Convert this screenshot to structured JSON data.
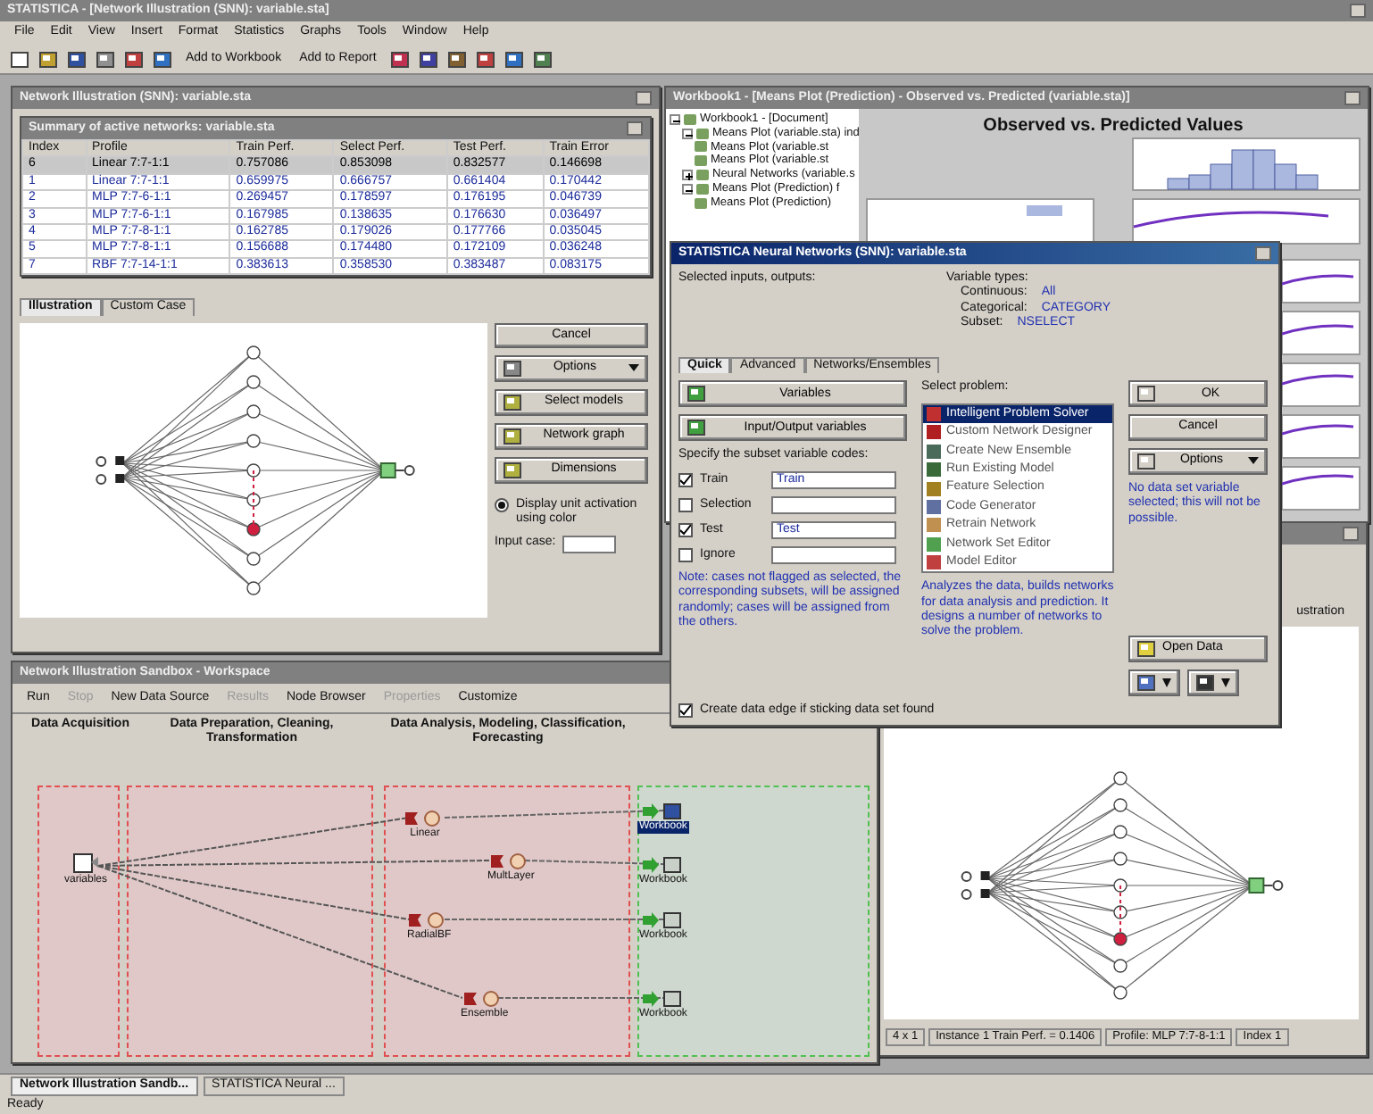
{
  "app": {
    "title": "STATISTICA - [Network Illustration (SNN): variable.sta]",
    "menu": [
      "File",
      "Edit",
      "View",
      "Insert",
      "Format",
      "Statistics",
      "Graphs",
      "Tools",
      "Window",
      "Help"
    ],
    "toolbar": [
      "Add to Workbook",
      "Add to Report"
    ]
  },
  "illustration_window": {
    "title": "Network Illustration (SNN): variable.sta",
    "results": {
      "title": "Summary of active networks: variable.sta",
      "columns": [
        "Index",
        "Profile",
        "Train Perf.",
        "Select Perf.",
        "Test Perf.",
        "Train Error"
      ],
      "rows": [
        {
          "cells": [
            "6",
            "Linear 7:7-1:1",
            "0.757086",
            "0.853098",
            "0.832577",
            "0.146698"
          ],
          "selected": true
        },
        {
          "cells": [
            "1",
            "Linear 7:7-1:1",
            "0.659975",
            "0.666757",
            "0.661404",
            "0.170442"
          ],
          "selected": false
        },
        {
          "cells": [
            "2",
            "MLP 7:7-6-1:1",
            "0.269457",
            "0.178597",
            "0.176195",
            "0.046739"
          ],
          "selected": false
        },
        {
          "cells": [
            "3",
            "MLP 7:7-6-1:1",
            "0.167985",
            "0.138635",
            "0.176630",
            "0.036497"
          ],
          "selected": false
        },
        {
          "cells": [
            "4",
            "MLP 7:7-8-1:1",
            "0.162785",
            "0.179026",
            "0.177766",
            "0.035045"
          ],
          "selected": false
        },
        {
          "cells": [
            "5",
            "MLP 7:7-8-1:1",
            "0.156688",
            "0.174480",
            "0.172109",
            "0.036248"
          ],
          "selected": false
        },
        {
          "cells": [
            "7",
            "RBF 7:7-14-1:1",
            "0.383613",
            "0.358530",
            "0.383487",
            "0.083175"
          ],
          "selected": false
        }
      ]
    },
    "tabs": [
      {
        "label": "Illustration",
        "selected": true
      },
      {
        "label": "Custom Case",
        "selected": false
      }
    ],
    "buttons": [
      {
        "label": "Cancel",
        "kind": "plain"
      },
      {
        "label": "Options",
        "kind": "menu"
      },
      {
        "label": "Select models",
        "kind": "icon"
      },
      {
        "label": "Network graph",
        "kind": "icon"
      },
      {
        "label": "Dimensions",
        "kind": "icon"
      }
    ],
    "display_option": {
      "label": "Display unit activation using color",
      "checked": true
    },
    "input_case": {
      "label": "Input case:"
    }
  },
  "workbook_window": {
    "title": "Workbook1 - [Means Plot (Prediction) - Observed vs. Predicted (variable.sta)]",
    "tree": [
      {
        "label": "Workbook1 - [Document]",
        "expanded": true,
        "children": [
          {
            "label": "Means Plot (variable.sta) ind",
            "expanded": true,
            "children": [
              {
                "label": "Means Plot (variable.st"
              },
              {
                "label": "Means Plot (variable.st"
              }
            ]
          },
          {
            "label": "Neural Networks (variable.s",
            "expanded": false
          },
          {
            "label": "Means Plot (Prediction) f",
            "expanded": true,
            "children": [
              {
                "label": "Means Plot (Prediction)"
              }
            ]
          }
        ]
      }
    ],
    "chart": {
      "title": "Observed vs. Predicted Values"
    }
  },
  "dialog": {
    "title": "STATISTICA Neural Networks (SNN): variable.sta",
    "inputs_label": "Selected inputs, outputs:",
    "types_label": "Variable types:",
    "types": [
      {
        "label": "Continuous:",
        "value": "All"
      },
      {
        "label": "Categorical:",
        "value": "CATEGORY"
      },
      {
        "label": "Subset:",
        "value": "NSELECT"
      }
    ],
    "tabs": [
      {
        "label": "Quick",
        "selected": true
      },
      {
        "label": "Advanced",
        "selected": false
      },
      {
        "label": "Networks/Ensembles",
        "selected": false
      }
    ],
    "variable_buttons": [
      "Variables",
      "Input/Output variables"
    ],
    "subset_label": "Specify the subset variable codes:",
    "subsets": [
      {
        "label": "Train",
        "checked": true,
        "value": "Train"
      },
      {
        "label": "Selection",
        "checked": false
      },
      {
        "label": "Test",
        "checked": true,
        "value": "Test"
      },
      {
        "label": "Ignore",
        "checked": false
      }
    ],
    "subset_note": "Note: cases not flagged as selected, the corresponding subsets, will be assigned randomly; cases will be assigned from the others.",
    "problem_label": "Select problem:",
    "problems": [
      {
        "label": "Intelligent Problem Solver",
        "selected": true,
        "color": "#c03030"
      },
      {
        "label": "Custom Network Designer",
        "selected": false,
        "color": "#b02020"
      },
      {
        "label": "Create New Ensemble",
        "selected": false,
        "color": "#4a6a5a"
      },
      {
        "label": "Run Existing Model",
        "selected": false,
        "color": "#3a6a3a"
      },
      {
        "label": "Feature Selection",
        "selected": false,
        "color": "#a08020"
      },
      {
        "label": "Code Generator",
        "selected": false,
        "color": "#6070a0"
      },
      {
        "label": "Retrain Network",
        "selected": false,
        "color": "#c09050"
      },
      {
        "label": "Network Set Editor",
        "selected": false,
        "color": "#50a050"
      },
      {
        "label": "Model Editor",
        "selected": false,
        "color": "#c04040"
      }
    ],
    "problem_note": "Analyzes the data, builds networks for data analysis and prediction. It designs a number of networks to solve the problem.",
    "buttons": [
      "OK",
      "Cancel",
      "Options"
    ],
    "side_note": "No data set variable selected; this will not be possible.",
    "open_data": "Open Data",
    "create_option": {
      "label": "Create data edge if sticking data set found",
      "checked": true
    }
  },
  "graph_window": {
    "tab": "ustration",
    "status": [
      "4 x 1",
      "Instance 1 Train Perf. = 0.1406",
      "Profile: MLP 7:7-8-1:1",
      "Index 1"
    ]
  },
  "workspace": {
    "title": "Network Illustration Sandbox - Workspace",
    "toolbar": [
      {
        "label": "Run",
        "disabled": false
      },
      {
        "label": "Stop",
        "disabled": true
      },
      {
        "label": "New Data Source",
        "disabled": false
      },
      {
        "label": "Results",
        "disabled": true
      },
      {
        "label": "Node Browser",
        "disabled": false
      },
      {
        "label": "Properties",
        "disabled": true
      },
      {
        "label": "Customize",
        "disabled": false
      }
    ],
    "stages": [
      "Data Acquisition",
      "Data Preparation, Cleaning, Transformation",
      "Data Analysis, Modeling, Classification, Forecasting"
    ],
    "source": {
      "label": "variables"
    },
    "models": [
      {
        "label": "Linear"
      },
      {
        "label": "MultLayer"
      },
      {
        "label": "RadialBF"
      },
      {
        "label": "Ensemble"
      }
    ],
    "outputs": [
      {
        "label": "Workbook",
        "selected": true
      },
      {
        "label": "Workbook",
        "selected": false
      },
      {
        "label": "Workbook",
        "selected": false
      },
      {
        "label": "Workbook",
        "selected": false
      }
    ]
  },
  "taskbar": [
    {
      "label": "Network Illustration Sandb...",
      "selected": true
    },
    {
      "label": "STATISTICA Neural ...",
      "selected": false
    }
  ],
  "status": "Ready"
}
